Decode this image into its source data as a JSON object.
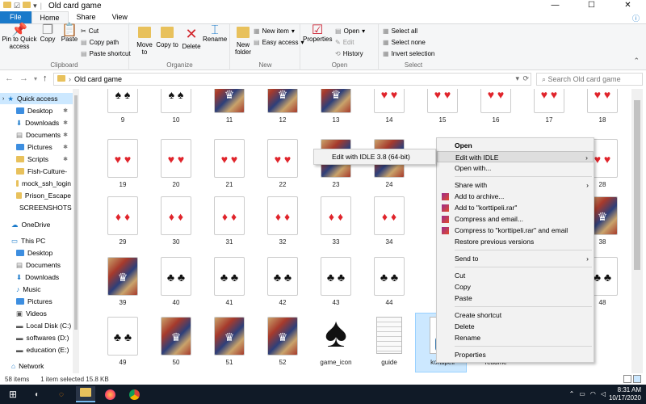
{
  "window": {
    "title": "Old card game",
    "controls": {
      "minimize": "—",
      "maximize": "☐",
      "close": "✕"
    }
  },
  "ribbon_tabs": {
    "file": "File",
    "home": "Home",
    "share": "Share",
    "view": "View"
  },
  "ribbon": {
    "clipboard": {
      "label": "Clipboard",
      "pin": "Pin to Quick access",
      "copy": "Copy",
      "paste": "Paste",
      "cut": "Cut",
      "copy_path": "Copy path",
      "paste_shortcut": "Paste shortcut"
    },
    "organize": {
      "label": "Organize",
      "move_to": "Move to",
      "copy_to": "Copy to",
      "delete": "Delete",
      "rename": "Rename"
    },
    "new": {
      "label": "New",
      "new_folder": "New folder",
      "new_item": "New item",
      "easy_access": "Easy access"
    },
    "open": {
      "label": "Open",
      "properties": "Properties",
      "open": "Open",
      "edit": "Edit",
      "history": "History"
    },
    "select": {
      "label": "Select",
      "select_all": "Select all",
      "select_none": "Select none",
      "invert": "Invert selection"
    }
  },
  "address": {
    "path": "Old card game",
    "search_placeholder": "Search Old card game"
  },
  "nav_pane": {
    "quick_access": "Quick access",
    "items": [
      "Desktop",
      "Downloads",
      "Documents",
      "Pictures",
      "Scripts",
      "Fish-Culture-",
      "mock_ssh_login",
      "Prison_Escape",
      "SCREENSHOTS"
    ],
    "onedrive": "OneDrive",
    "this_pc": "This PC",
    "pc_items": [
      "Desktop",
      "Documents",
      "Downloads",
      "Music",
      "Pictures",
      "Videos",
      "Local Disk (C:)",
      "softwares (D:)",
      "education (E:)"
    ],
    "network": "Network"
  },
  "files": {
    "row1": [
      "9",
      "10",
      "11",
      "12",
      "13",
      "14",
      "15",
      "16",
      "17",
      "18"
    ],
    "row2": [
      "19",
      "20",
      "21",
      "22",
      "23",
      "24",
      "",
      "",
      "",
      "28"
    ],
    "row3": [
      "29",
      "30",
      "31",
      "32",
      "33",
      "34",
      "",
      "",
      "",
      "38"
    ],
    "row4": [
      "39",
      "40",
      "41",
      "42",
      "43",
      "44",
      "",
      "",
      "",
      "48"
    ],
    "row5": [
      "49",
      "50",
      "51",
      "52",
      "game_icon",
      "guide",
      "korttipeli",
      "readme"
    ]
  },
  "status": {
    "count": "58 items",
    "selected": "1 item selected  15.8 KB"
  },
  "context_menu": {
    "items": [
      "Open",
      "Edit with IDLE",
      "Open with...",
      "Share with",
      "Add to archive...",
      "Add to \"korttipeli.rar\"",
      "Compress and email...",
      "Compress to \"korttipeli.rar\" and email",
      "Restore previous versions",
      "Send to",
      "Cut",
      "Copy",
      "Paste",
      "Create shortcut",
      "Delete",
      "Rename",
      "Properties"
    ]
  },
  "submenu": {
    "item": "Edit with IDLE 3.8 (64-bit)"
  },
  "taskbar": {
    "time": "8:31 AM",
    "date": "10/17/2020"
  },
  "colors": {
    "accent": "#1979ca",
    "selection": "#cce8ff",
    "taskbar": "#101a27"
  }
}
